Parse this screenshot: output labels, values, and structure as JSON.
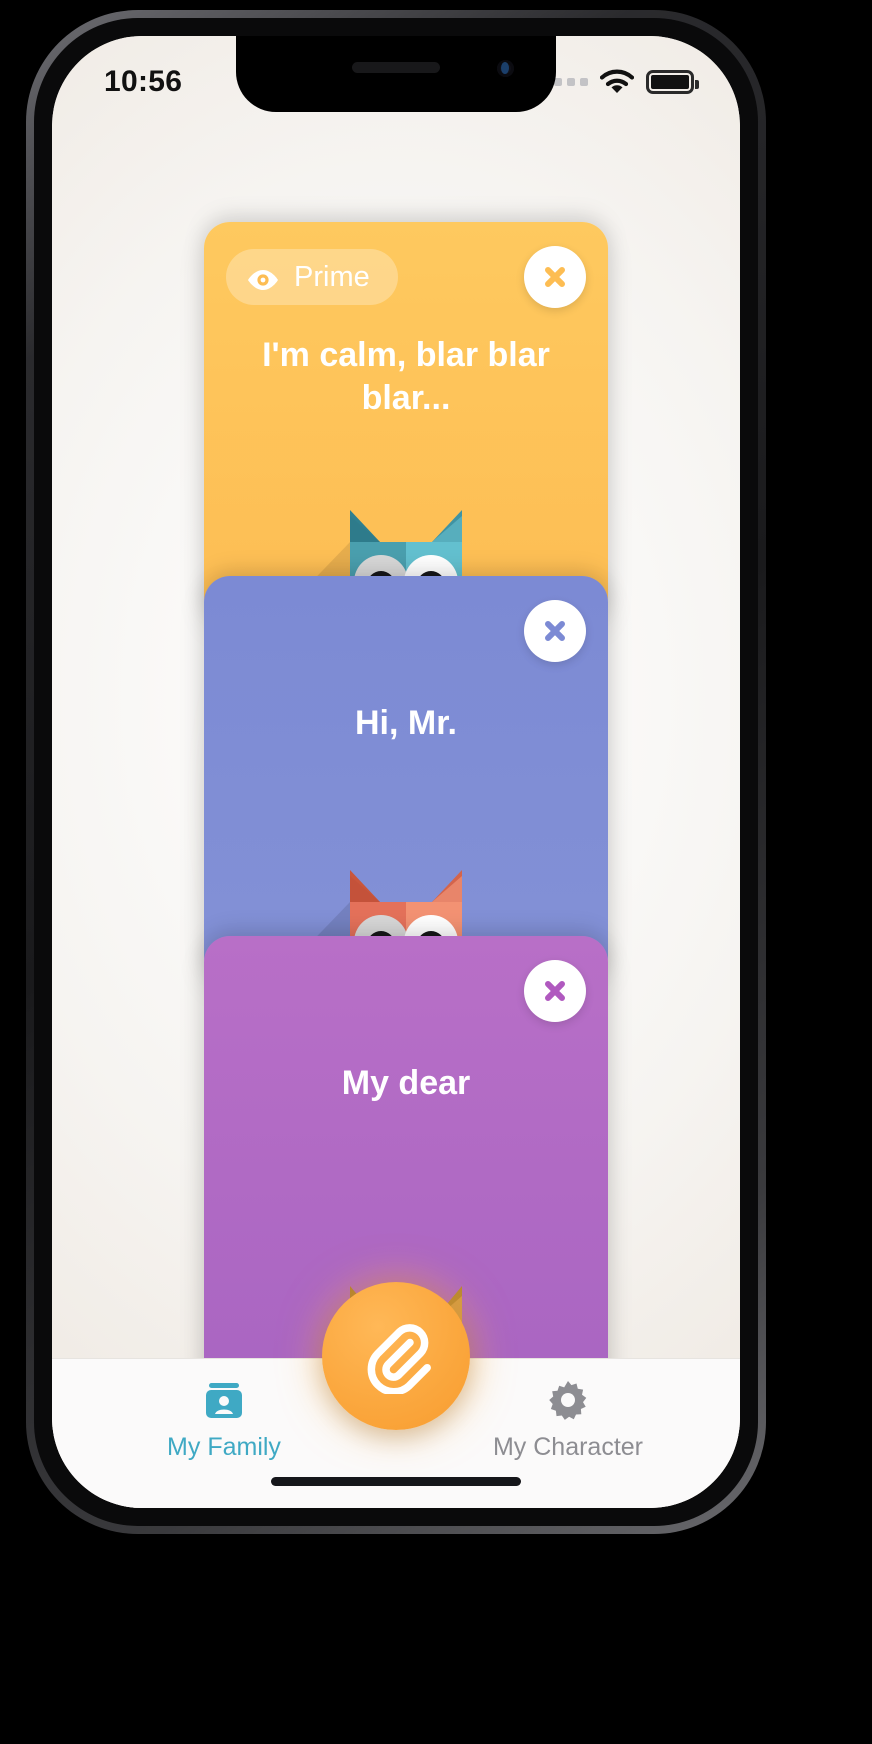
{
  "status_bar": {
    "time": "10:56",
    "signal_dots": 4,
    "wifi_icon": "wifi-icon",
    "battery_icon": "battery-full-icon"
  },
  "colors": {
    "card_orange": "#fec95f",
    "card_blue": "#7c8ad4",
    "card_purple": "#b86fc7",
    "fab_orange": "#fba83f",
    "tab_active": "#3fa9c4",
    "tab_inactive": "#8d8d92"
  },
  "cards": [
    {
      "id": "card-orange",
      "badge_label": "Prime",
      "badge_icon": "eye-icon",
      "message": "I'm calm, blar blar blar...",
      "close_icon": "close-icon",
      "owl": "owl-teal"
    },
    {
      "id": "card-blue",
      "badge_label": "",
      "message": "Hi, Mr.",
      "close_icon": "close-icon",
      "owl": "owl-salmon"
    },
    {
      "id": "card-purple",
      "badge_label": "",
      "message": "My dear",
      "close_icon": "close-icon",
      "owl": "owl-gold"
    }
  ],
  "fab": {
    "icon": "paperclip-icon",
    "label": "Attach"
  },
  "tabbar": {
    "items": [
      {
        "id": "my-family",
        "label": "My Family",
        "icon": "contact-card-icon",
        "active": true
      },
      {
        "id": "my-character",
        "label": "My Character",
        "icon": "gear-icon",
        "active": false
      }
    ]
  }
}
